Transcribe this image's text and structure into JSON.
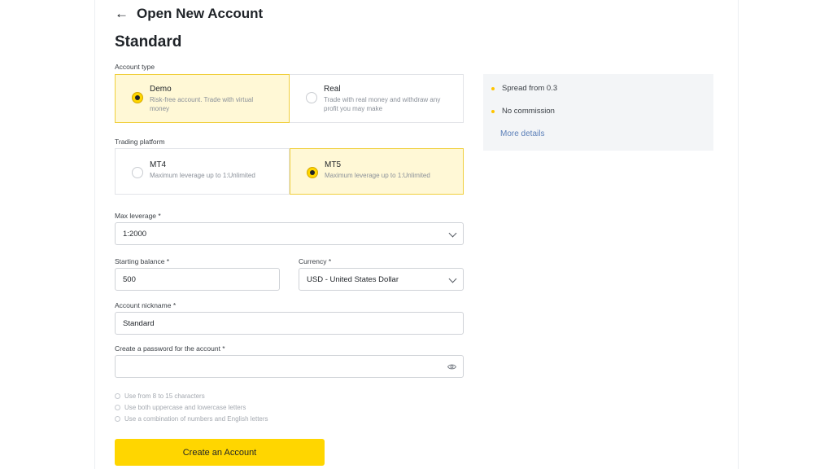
{
  "header": {
    "title": "Open New Account",
    "back_icon": "arrow-left-icon"
  },
  "subtitle": "Standard",
  "account_type": {
    "label": "Account type",
    "options": [
      {
        "title": "Demo",
        "desc_line1": "Risk-free account. Trade with virtual",
        "desc_line2": "money",
        "selected": true
      },
      {
        "title": "Real",
        "desc_line1": "Trade with real money and withdraw any",
        "desc_line2": "profit you may make",
        "selected": false
      }
    ]
  },
  "trading_platform": {
    "label": "Trading platform",
    "options": [
      {
        "title": "MT4",
        "desc": "Maximum leverage up to 1:Unlimited",
        "selected": false
      },
      {
        "title": "MT5",
        "desc": "Maximum leverage up to 1:Unlimited",
        "selected": true
      }
    ]
  },
  "max_leverage": {
    "label": "Max leverage *",
    "value": "1:2000"
  },
  "starting_balance": {
    "label": "Starting balance *",
    "value": "500"
  },
  "currency": {
    "label": "Currency *",
    "value": "USD - United States Dollar"
  },
  "nickname": {
    "label": "Account nickname *",
    "value": "Standard"
  },
  "password": {
    "label": "Create a password for the account *",
    "value": ""
  },
  "password_rules": [
    "Use from 8 to 15 characters",
    "Use both uppercase and lowercase letters",
    "Use a combination of numbers and English letters"
  ],
  "create_button": "Create an Account",
  "info": {
    "items": [
      "Spread from 0.3",
      "No commission"
    ],
    "link": "More details"
  },
  "colors": {
    "accent": "#ffd600",
    "selected_bg": "#fff8d6",
    "link": "#5b7fb8"
  }
}
